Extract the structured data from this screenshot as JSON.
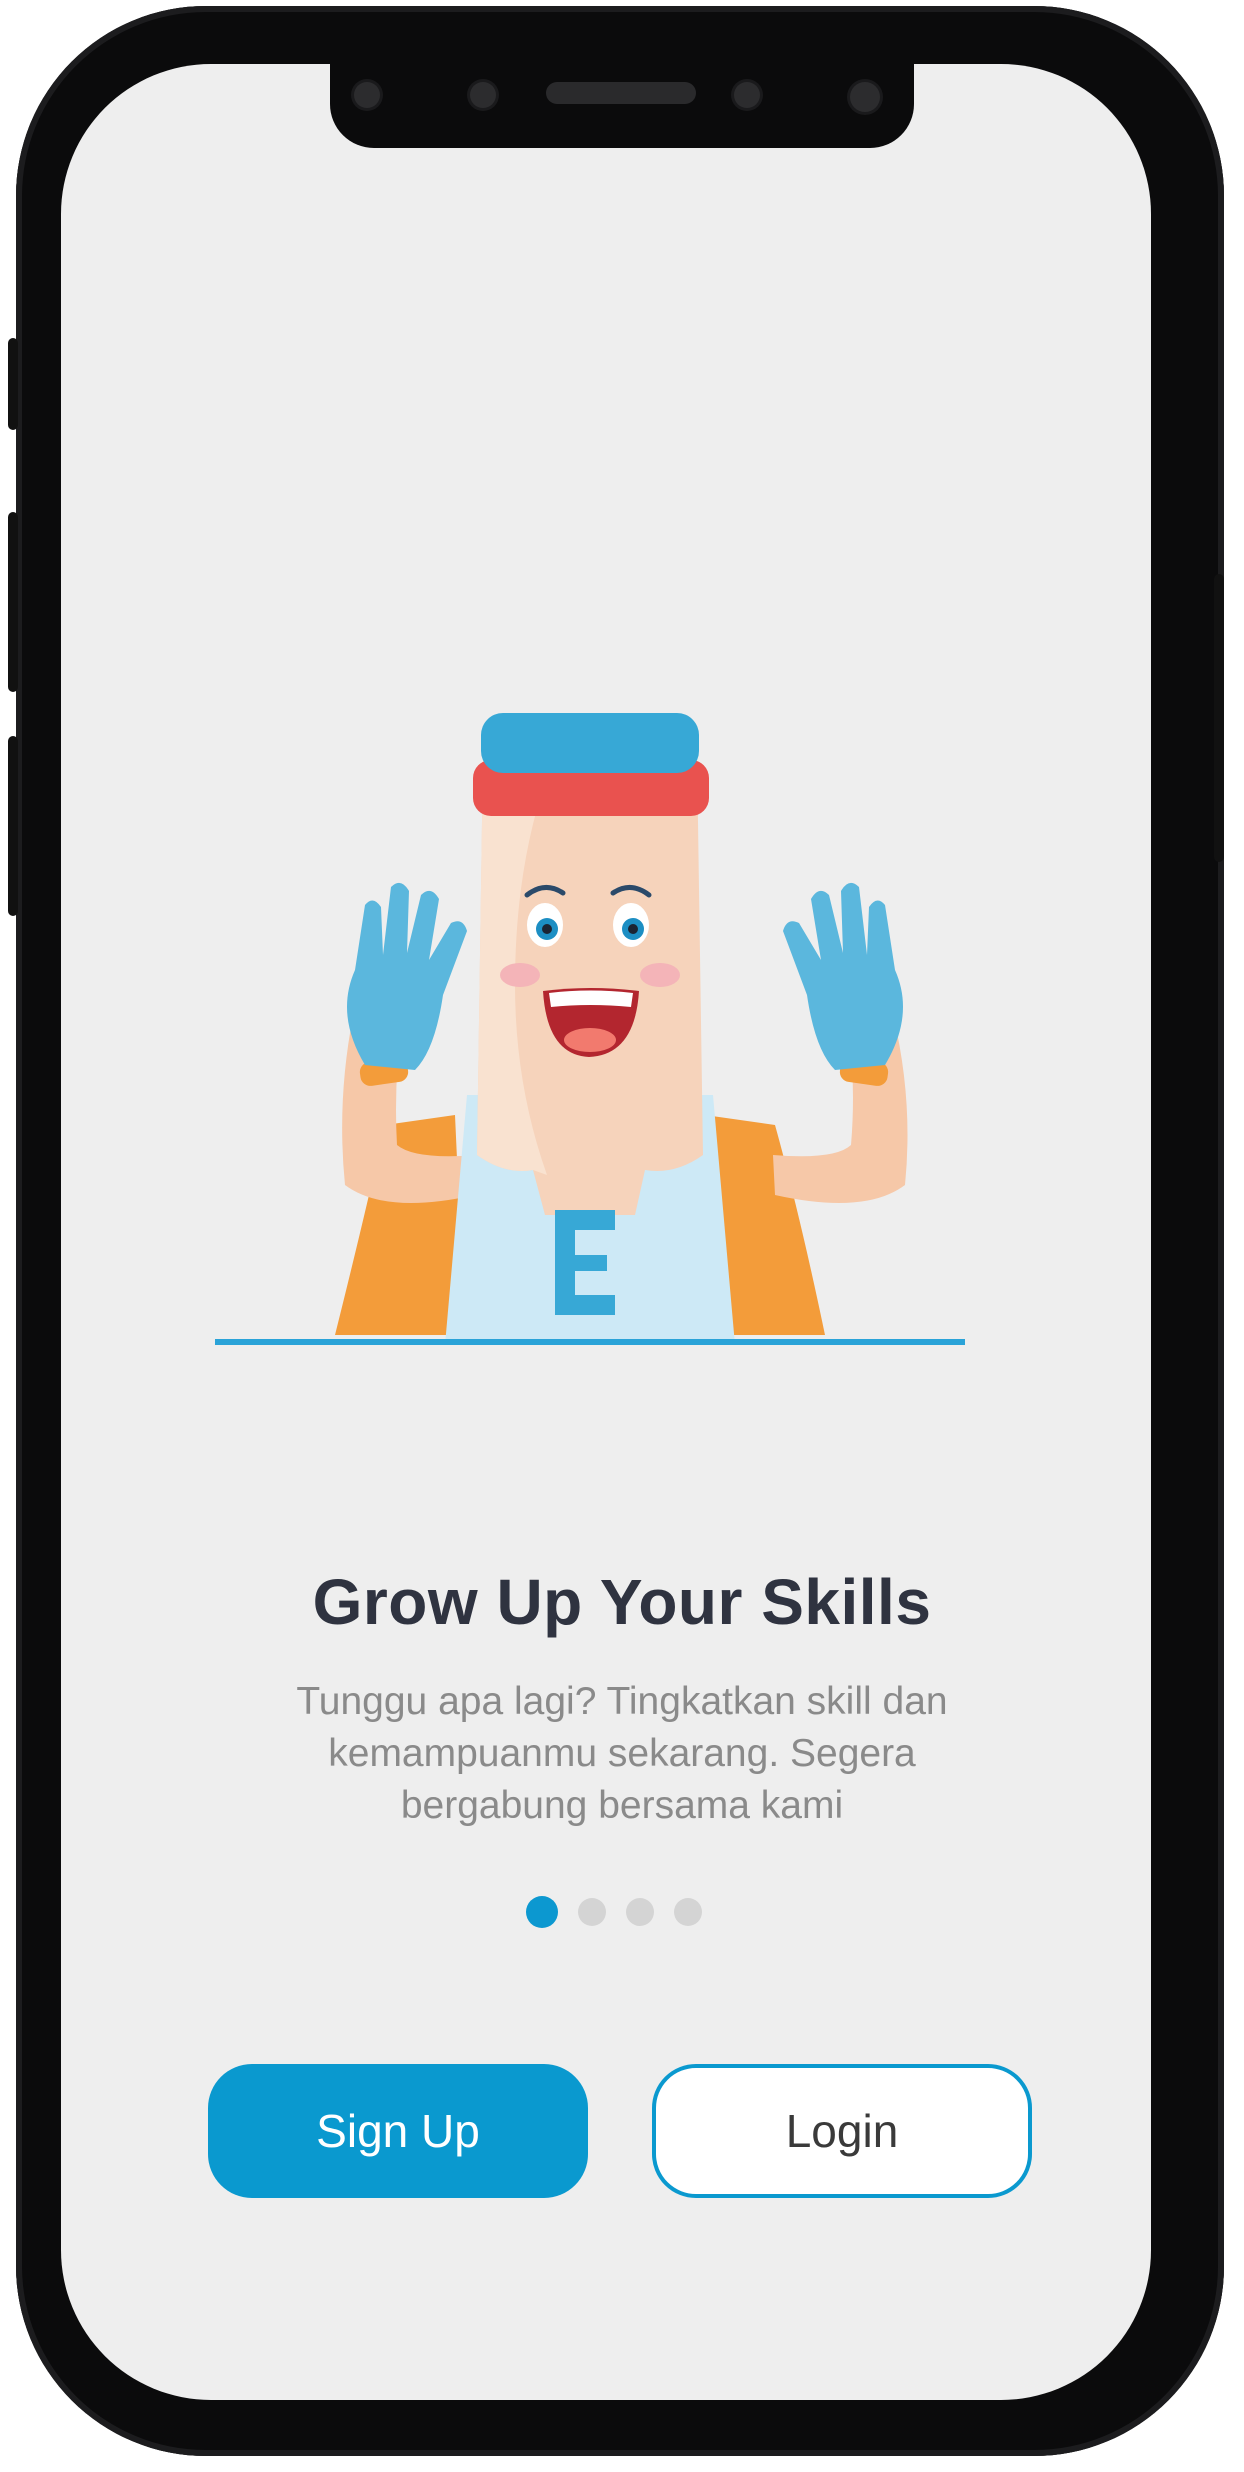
{
  "onboarding": {
    "title": "Grow Up Your Skills",
    "subtitle_line1": "Tunggu apa lagi? Tingkatkan skill dan",
    "subtitle_line2": "kemampuanmu sekarang. Segera",
    "subtitle_line3": "bergabung bersama kami",
    "page_indicator": {
      "total": 4,
      "current": 1
    },
    "mascot_logo_letter": "E"
  },
  "actions": {
    "signup_label": "Sign Up",
    "login_label": "Login"
  },
  "colors": {
    "accent": "#0a99cf",
    "screen_background": "#eeeeee",
    "title": "#2f3340",
    "subtitle": "#8a8a8a"
  },
  "icons": [
    "mascot-illustration"
  ]
}
